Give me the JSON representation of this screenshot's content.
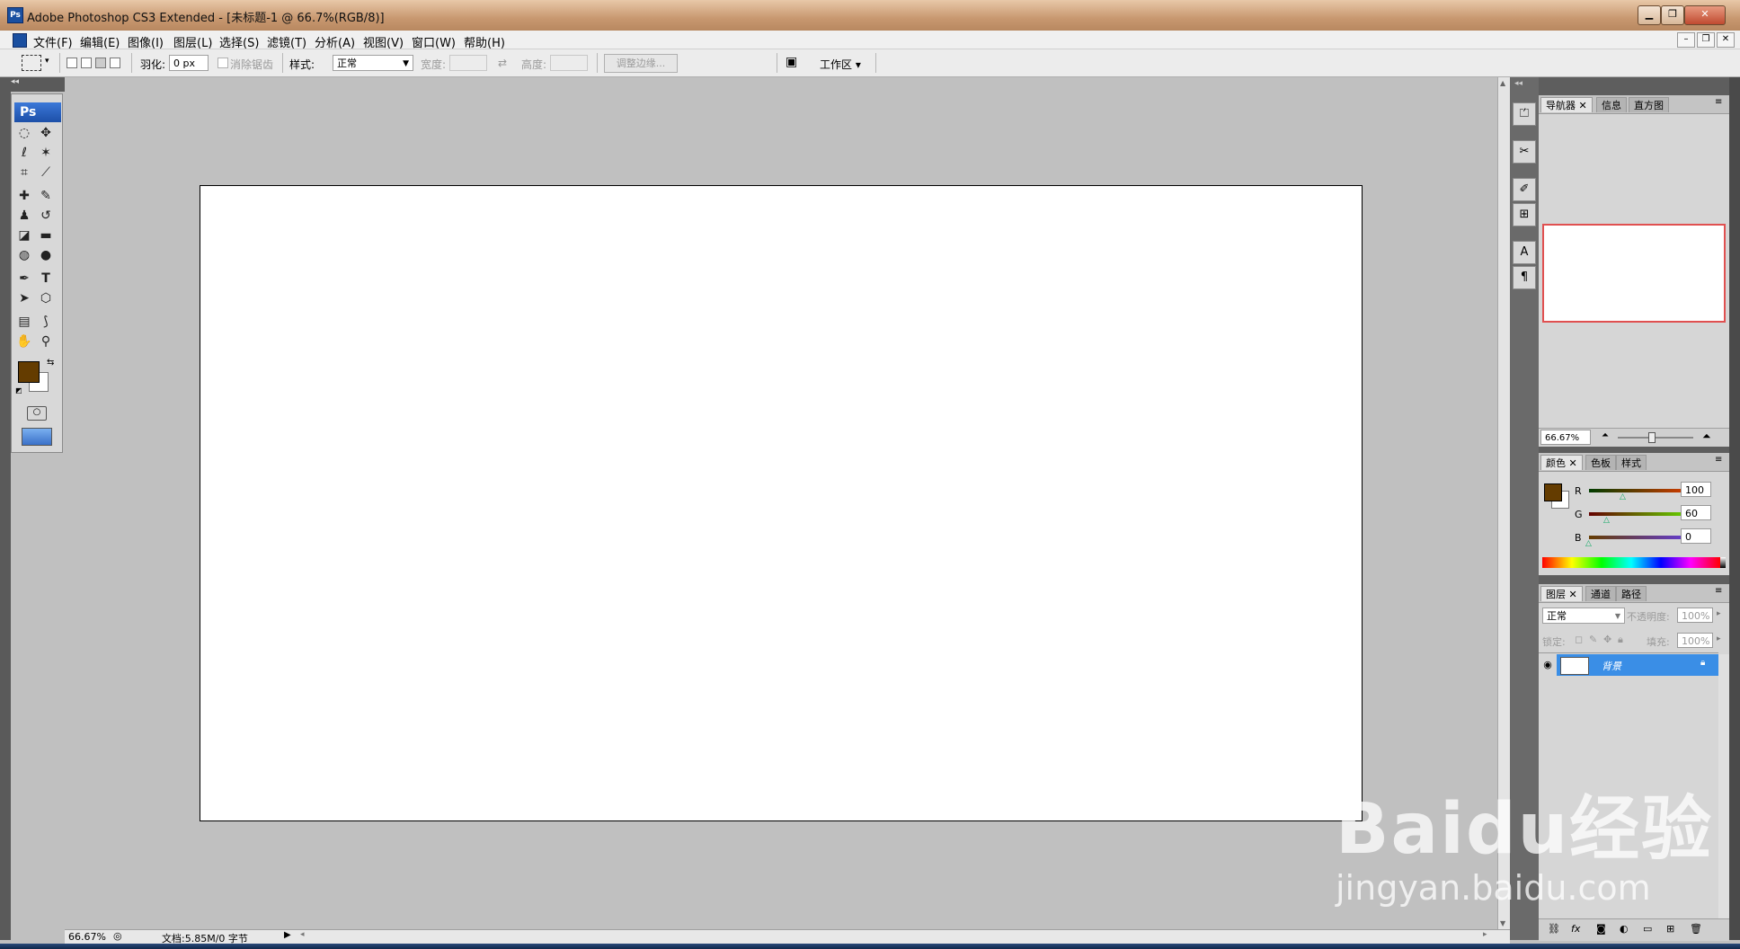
{
  "window": {
    "title": "Adobe Photoshop CS3 Extended - [未标题-1 @ 66.7%(RGB/8)]",
    "app_icon": "Ps"
  },
  "menu": [
    "文件(F)",
    "编辑(E)",
    "图像(I)",
    "图层(L)",
    "选择(S)",
    "滤镜(T)",
    "分析(A)",
    "视图(V)",
    "窗口(W)",
    "帮助(H)"
  ],
  "options": {
    "feather_label": "羽化:",
    "feather_value": "0 px",
    "antialias_label": "消除锯齿",
    "style_label": "样式:",
    "style_value": "正常",
    "width_label": "宽度:",
    "height_label": "高度:",
    "refine_edge": "调整边缘...",
    "workspace": "工作区 ▾"
  },
  "toolbox": {
    "logo": "Ps",
    "foreground_color": "#643c00",
    "background_color": "#ffffff"
  },
  "status": {
    "zoom": "66.67%",
    "doc_info": "文档:5.85M/0 字节"
  },
  "navigator": {
    "tabs": [
      "导航器",
      "信息",
      "直方图"
    ],
    "zoom": "66.67%"
  },
  "color_panel": {
    "tabs": [
      "颜色",
      "色板",
      "样式"
    ],
    "channels": [
      {
        "label": "R",
        "value": "100"
      },
      {
        "label": "G",
        "value": "60"
      },
      {
        "label": "B",
        "value": "0"
      }
    ]
  },
  "layers_panel": {
    "tabs": [
      "图层",
      "通道",
      "路径"
    ],
    "blend_mode": "正常",
    "opacity_label": "不透明度:",
    "opacity_value": "100%",
    "lock_label": "锁定:",
    "fill_label": "填充:",
    "fill_value": "100%",
    "layers": [
      {
        "name": "背景"
      }
    ]
  },
  "watermark": {
    "logo": "Baidu经验",
    "url": "jingyan.baidu.com"
  }
}
